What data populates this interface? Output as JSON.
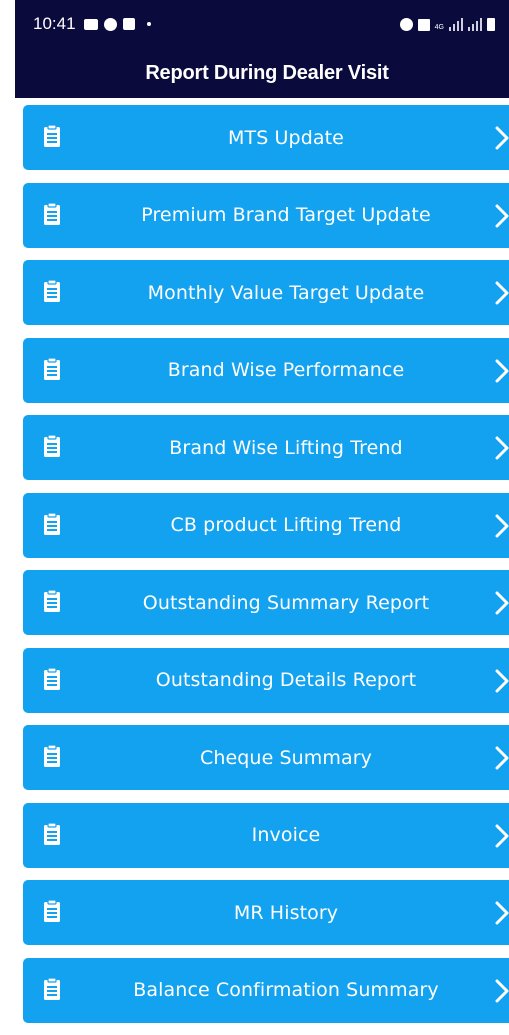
{
  "status_bar": {
    "time": "10:41",
    "network_label": "4G",
    "left_icons": [
      "gallery-icon",
      "messenger-icon",
      "facebook-icon",
      "notification-dot-icon"
    ],
    "right_icons": [
      "alarm-icon",
      "mute-icon",
      "signal-icon",
      "signal-icon",
      "battery-icon"
    ]
  },
  "app_bar": {
    "title": "Report During Dealer Visit"
  },
  "menu": {
    "item_icon": "clipboard-icon",
    "item_chevron": "chevron-right-icon",
    "items": [
      {
        "label": "MTS Update"
      },
      {
        "label": "Premium Brand Target Update"
      },
      {
        "label": "Monthly Value Target Update"
      },
      {
        "label": "Brand Wise Performance"
      },
      {
        "label": "Brand Wise Lifting Trend"
      },
      {
        "label": "CB product Lifting Trend"
      },
      {
        "label": "Outstanding Summary Report"
      },
      {
        "label": "Outstanding Details Report"
      },
      {
        "label": "Cheque Summary"
      },
      {
        "label": "Invoice"
      },
      {
        "label": "MR History"
      },
      {
        "label": "Balance Confirmation Summary"
      }
    ]
  },
  "colors": {
    "app_bar_bg": "#0b0a3c",
    "item_bg": "#12a2f0",
    "item_text": "#ffffff"
  }
}
